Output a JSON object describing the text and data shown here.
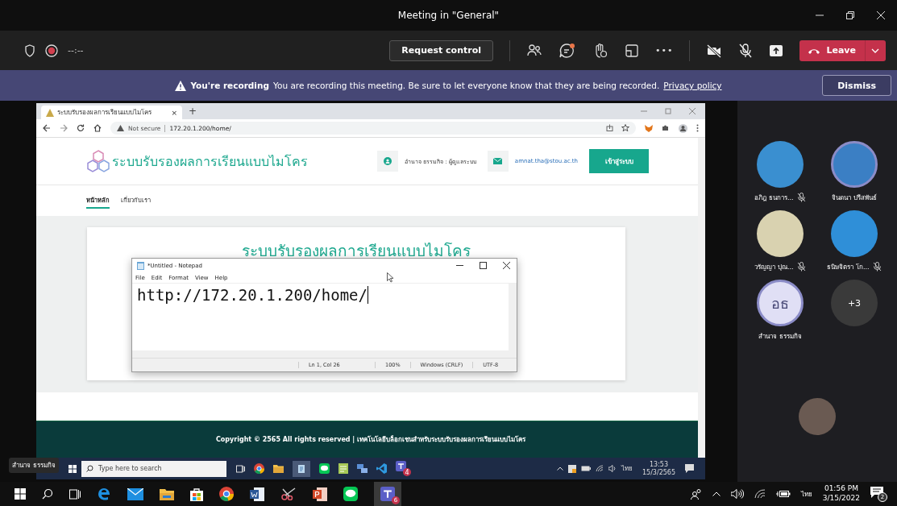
{
  "window": {
    "title": "Meeting in \"General\""
  },
  "toolbar": {
    "recording": true,
    "timer": "--:--",
    "request_control": "Request control",
    "chat_unread": true,
    "more": "•••",
    "leave": "Leave"
  },
  "banner": {
    "title": "You're recording",
    "message": "You are recording this meeting. Be sure to let everyone know that they are being recorded.",
    "link": "Privacy policy",
    "dismiss": "Dismiss"
  },
  "shared_screen": {
    "browser": {
      "tab_title": "ระบบรับรองผลการเรียนแบบไมโคร",
      "close": "×",
      "new_tab": "+",
      "not_secure": "Not secure",
      "url": "172.20.1.200/home/"
    },
    "site": {
      "logo": "ระบบรับรองผลการเรียนแบบไมโคร",
      "user": "อำนาจ ธรรมกิจ : ผู้ดูแลระบบ",
      "email": "amnat.tha@stou.ac.th",
      "login": "เข้าสู่ระบบ",
      "nav": [
        {
          "label": "หน้าหลัก",
          "selected": true
        },
        {
          "label": "เกี่ยวกับเรา",
          "selected": false
        }
      ],
      "heading": "ระบบรับรองผลการเรียนแบบไมโคร",
      "footer": "Copyright © 2565 All rights reserved | เทคโนโลยีบล็อกเชนสำหรับระบบรับรองผลการเรียนแบบไมโคร"
    },
    "notepad": {
      "title": "*Untitled - Notepad",
      "menu": [
        "File",
        "Edit",
        "Format",
        "View",
        "Help"
      ],
      "text": "http://172.20.1.200/home/",
      "status": [
        "Ln 1, Col 26",
        "100%",
        "Windows (CRLF)",
        "UTF-8"
      ]
    },
    "taskbar": {
      "search_placeholder": "Type here to search",
      "teams_badge": "4",
      "language": "ไทย",
      "time": "13:53",
      "date": "15/3/2565"
    },
    "tooltip": "สำนาจ ธรรมกิจ"
  },
  "participants": [
    {
      "name": "อภิฎ ธนการ...",
      "kind": "photo",
      "speaking": false,
      "muted": true
    },
    {
      "name": "จินดนา ปรีสพันธ์",
      "kind": "photo",
      "speaking": true,
      "muted": false
    },
    {
      "name": "วรัญญา ปุณ...",
      "kind": "photo",
      "speaking": false,
      "muted": true
    },
    {
      "name": "ธนิษจิตรา โก...",
      "kind": "photo",
      "speaking": false,
      "muted": true
    },
    {
      "name": "สำนาจ ธรรมกิจ",
      "kind": "initials",
      "initials": "อธ",
      "speaking": true,
      "muted": false
    }
  ],
  "overflow": "+3",
  "taskbar": {
    "teams_badge": "6",
    "language": "ไทย",
    "time": "01:56 PM",
    "date": "3/15/2022",
    "notifications": "2"
  }
}
